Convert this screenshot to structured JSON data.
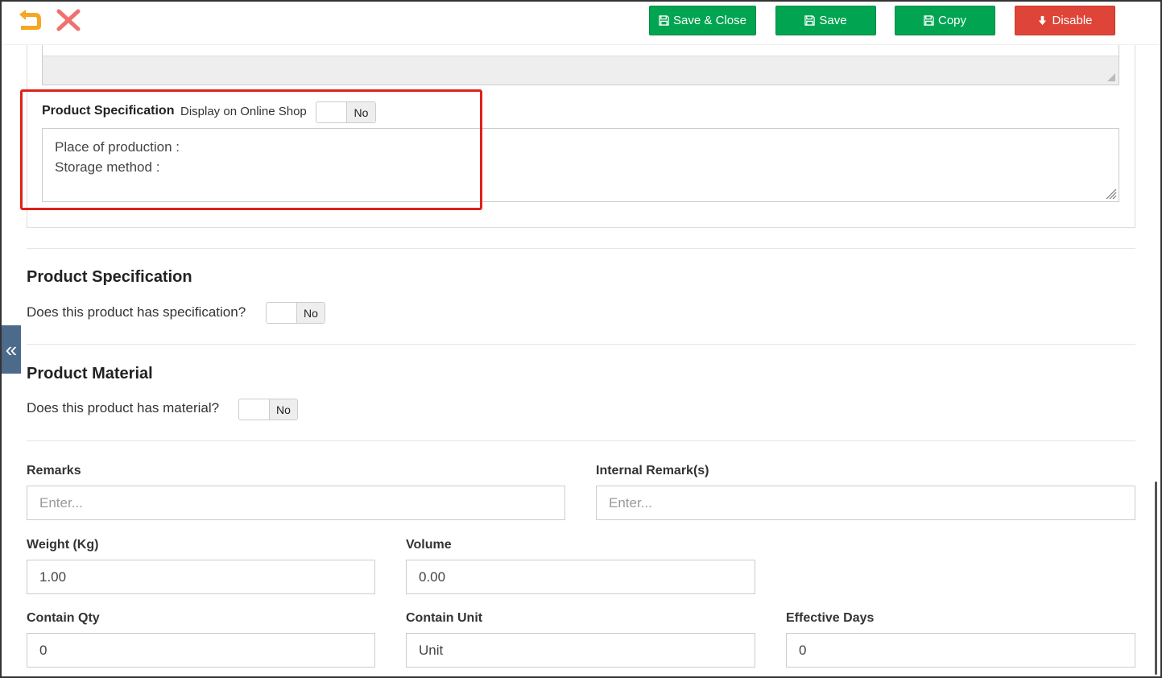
{
  "toolbar": {
    "back_icon": "undo-arrow-icon",
    "close_icon": "close-x-icon",
    "save_close_label": "Save & Close",
    "save_label": "Save",
    "copy_label": "Copy",
    "disable_label": "Disable",
    "colors": {
      "green": "#00a451",
      "red": "#de4437",
      "back_icon": "#f5a623",
      "close_icon": "#f07070"
    }
  },
  "online_spec": {
    "label": "Product Specification",
    "sublabel": "Display on Online Shop",
    "toggle_value": "No",
    "text_line1": "Place of production :",
    "text_line2": "Storage method :"
  },
  "product_specification": {
    "title": "Product Specification",
    "question": "Does this product has specification?",
    "toggle_value": "No"
  },
  "product_material": {
    "title": "Product Material",
    "question": "Does this product has material?",
    "toggle_value": "No"
  },
  "side_tab": {
    "icon": "double-chevron-left-icon",
    "glyph": "«"
  },
  "fields": {
    "remarks": {
      "label": "Remarks",
      "placeholder": "Enter..."
    },
    "internal_remarks": {
      "label": "Internal Remark(s)",
      "placeholder": "Enter..."
    },
    "weight": {
      "label": "Weight (Kg)",
      "value": "1.00"
    },
    "volume": {
      "label": "Volume",
      "value": "0.00"
    },
    "contain_qty": {
      "label": "Contain Qty",
      "value": "0"
    },
    "contain_unit": {
      "label": "Contain Unit",
      "value": "Unit"
    },
    "effective_days": {
      "label": "Effective Days",
      "value": "0"
    }
  }
}
